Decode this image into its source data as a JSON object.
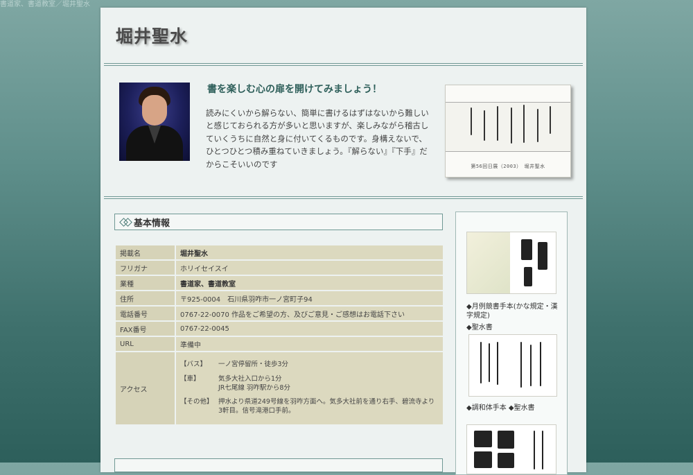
{
  "breadcrumb": "書道家、書道教室／堀井聖水",
  "site": {
    "title": "堀井聖水"
  },
  "intro": {
    "tagline": "書を楽しむ心の扉を開けてみましょう！",
    "paragraph": "読みにくいから解らない、簡単に書けるはずはないから難しいと感じておられる方が多いと思いますが、楽しみながら稽古していくうちに自然と身に付いてくるものです。身構えないで、ひとつひとつ積み重ねていきましょう。『解らない』『下手』だからこそいいのです",
    "artwork_caption": "第56回日展（2003）　堀井聖水"
  },
  "basic_info": {
    "heading": "基本情報",
    "rows": [
      {
        "label": "掲載名",
        "value": "堀井聖水"
      },
      {
        "label": "フリガナ",
        "value": "ホリイセイスイ"
      },
      {
        "label": "業種",
        "value": "書道家、書道教室"
      },
      {
        "label": "住所",
        "value": "〒925-0004　石川県羽咋市一ノ宮町子94"
      },
      {
        "label": "電話番号",
        "value": "0767-22-0070 作品をご希望の方、及びご意見・ご感想はお電話下さい"
      },
      {
        "label": "FAX番号",
        "value": "0767-22-0045"
      },
      {
        "label": "URL",
        "value": "準備中"
      }
    ],
    "access": {
      "label": "アクセス",
      "bus_label": "【バス】",
      "bus": "一ノ宮停留所・徒歩3分",
      "car_label": "【車】",
      "car_1": "気多大社入口から1分",
      "car_2": "JR七尾線 羽咋駅から8分",
      "other_label": "【その他】",
      "other": "押水より県道249号線を羽咋方面へ。気多大社前を通り右手、碧流寺より3軒目。信号滝港口手前。"
    }
  },
  "sidebar": {
    "caption_1": "◆月例競書手本(かな規定・漢字規定)",
    "caption_2": "◆聖水書",
    "caption_3": "◆調和体手本 ◆聖水書"
  }
}
